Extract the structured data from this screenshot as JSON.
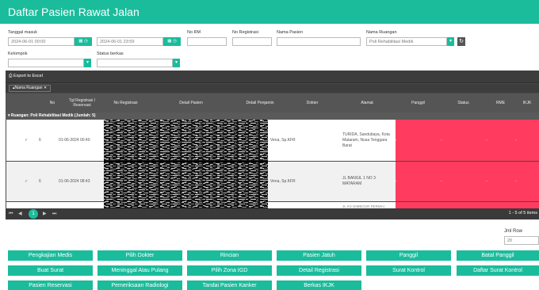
{
  "page": {
    "title": "Daftar Pasien Rawat Jalan"
  },
  "filters": {
    "tanggal_masuk_label": "Tanggal masuk",
    "tanggal_dari": "2024-06-01 00:00",
    "tanggal_sampai": "2024-06-01 23:59",
    "no_rm_label": "No RM",
    "no_registrasi_label": "No Registrasi",
    "nama_pasien_label": "Nama Pasien",
    "nama_ruangan_label": "Nama Ruangan",
    "nama_ruangan_value": "Poli Rehabilitasi Medik",
    "kelompok_label": "Kelompok",
    "status_berkas_label": "Status berkas"
  },
  "grid": {
    "export_label": "Export to Excel",
    "group_chip": "Nama Ruangan",
    "columns": [
      "",
      "No",
      "Tgl Registrasi / Reservasi",
      "No Registrasi",
      "Detail Pasien",
      "Detail Penjamin",
      "Dokter",
      "Alamat",
      "Panggil",
      "Status",
      "RME",
      "IKJK"
    ],
    "group_header": "Ruangan: Poli Rehabilitasi Medik (Jumlah: 5)",
    "rows": [
      {
        "check": "✓",
        "no": "6",
        "tgl": "01-06-2024 00:40",
        "dokter": "dr. Vena, Sp.KFR",
        "alamat": "TURIDA, Sandubaya, Kota Mataram, Nusa Tenggara Barat"
      },
      {
        "check": "✓",
        "no": "6",
        "tgl": "01-06-2024 08:43",
        "dokter": "dr. Vena, Sp.KFR",
        "alamat": "JL BANGIL 1 NO 3 MATARAM"
      },
      {
        "alamat": "JL KS NIMBOUR PERMAI"
      }
    ],
    "pager": {
      "first": "⏮",
      "prev": "◀",
      "current": "1",
      "next": "▶",
      "last": "⏭",
      "info": "1 - 5 of 5 items"
    }
  },
  "jml_row": {
    "label": "Jml Row",
    "value": "20"
  },
  "actions": [
    [
      "Pengkajian Medis",
      "Pilih Dokter",
      "Rincian",
      "Pasien Jatuh",
      "Panggil",
      "Batal Panggil"
    ],
    [
      "Buat Surat",
      "Meninggal Atau Pulang",
      "Pilih Zona IGD",
      "Detail Registrasi",
      "Surat Kontrol",
      "Daftar Surat Kontrol"
    ],
    [
      "Pasien Reservasi",
      "Pemeriksaan Radiologi",
      "Tandai Pasien Kanker",
      "Berkas IKJK"
    ]
  ],
  "colors": {
    "accent": "#1abc9c",
    "grid_dark": "#4a4a4a",
    "status_red": "#ff3c5f"
  },
  "icons": {
    "calendar": "calendar-icon",
    "clock": "clock-icon",
    "dropdown": "chevron-down-icon",
    "refresh": "refresh-icon",
    "export": "printer-icon"
  }
}
